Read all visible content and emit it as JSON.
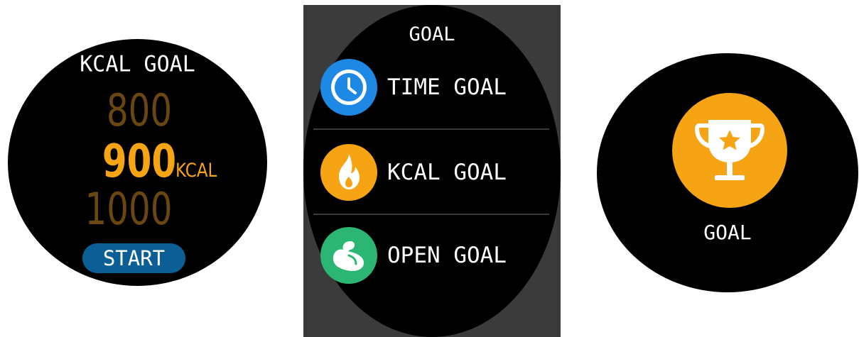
{
  "kcal_picker": {
    "title": "KCAL GOAL",
    "options": [
      "800",
      "900",
      "1000"
    ],
    "selected": "900",
    "unit": "KCAL",
    "start_label": "START",
    "colors": {
      "selected": "#f6a414",
      "unselected": "#6a4611",
      "start_button": "#0b5f96"
    }
  },
  "goal_list": {
    "title": "GOAL",
    "items": [
      {
        "label": "TIME GOAL",
        "icon": "clock-icon",
        "color": "#1e88e5"
      },
      {
        "label": "KCAL GOAL",
        "icon": "flame-icon",
        "color": "#f6a414"
      },
      {
        "label": "OPEN GOAL",
        "icon": "muscle-arm-icon",
        "color": "#2bb673"
      }
    ]
  },
  "goal_tile": {
    "label": "GOAL",
    "icon": "trophy-star-icon",
    "color": "#f6a414"
  }
}
